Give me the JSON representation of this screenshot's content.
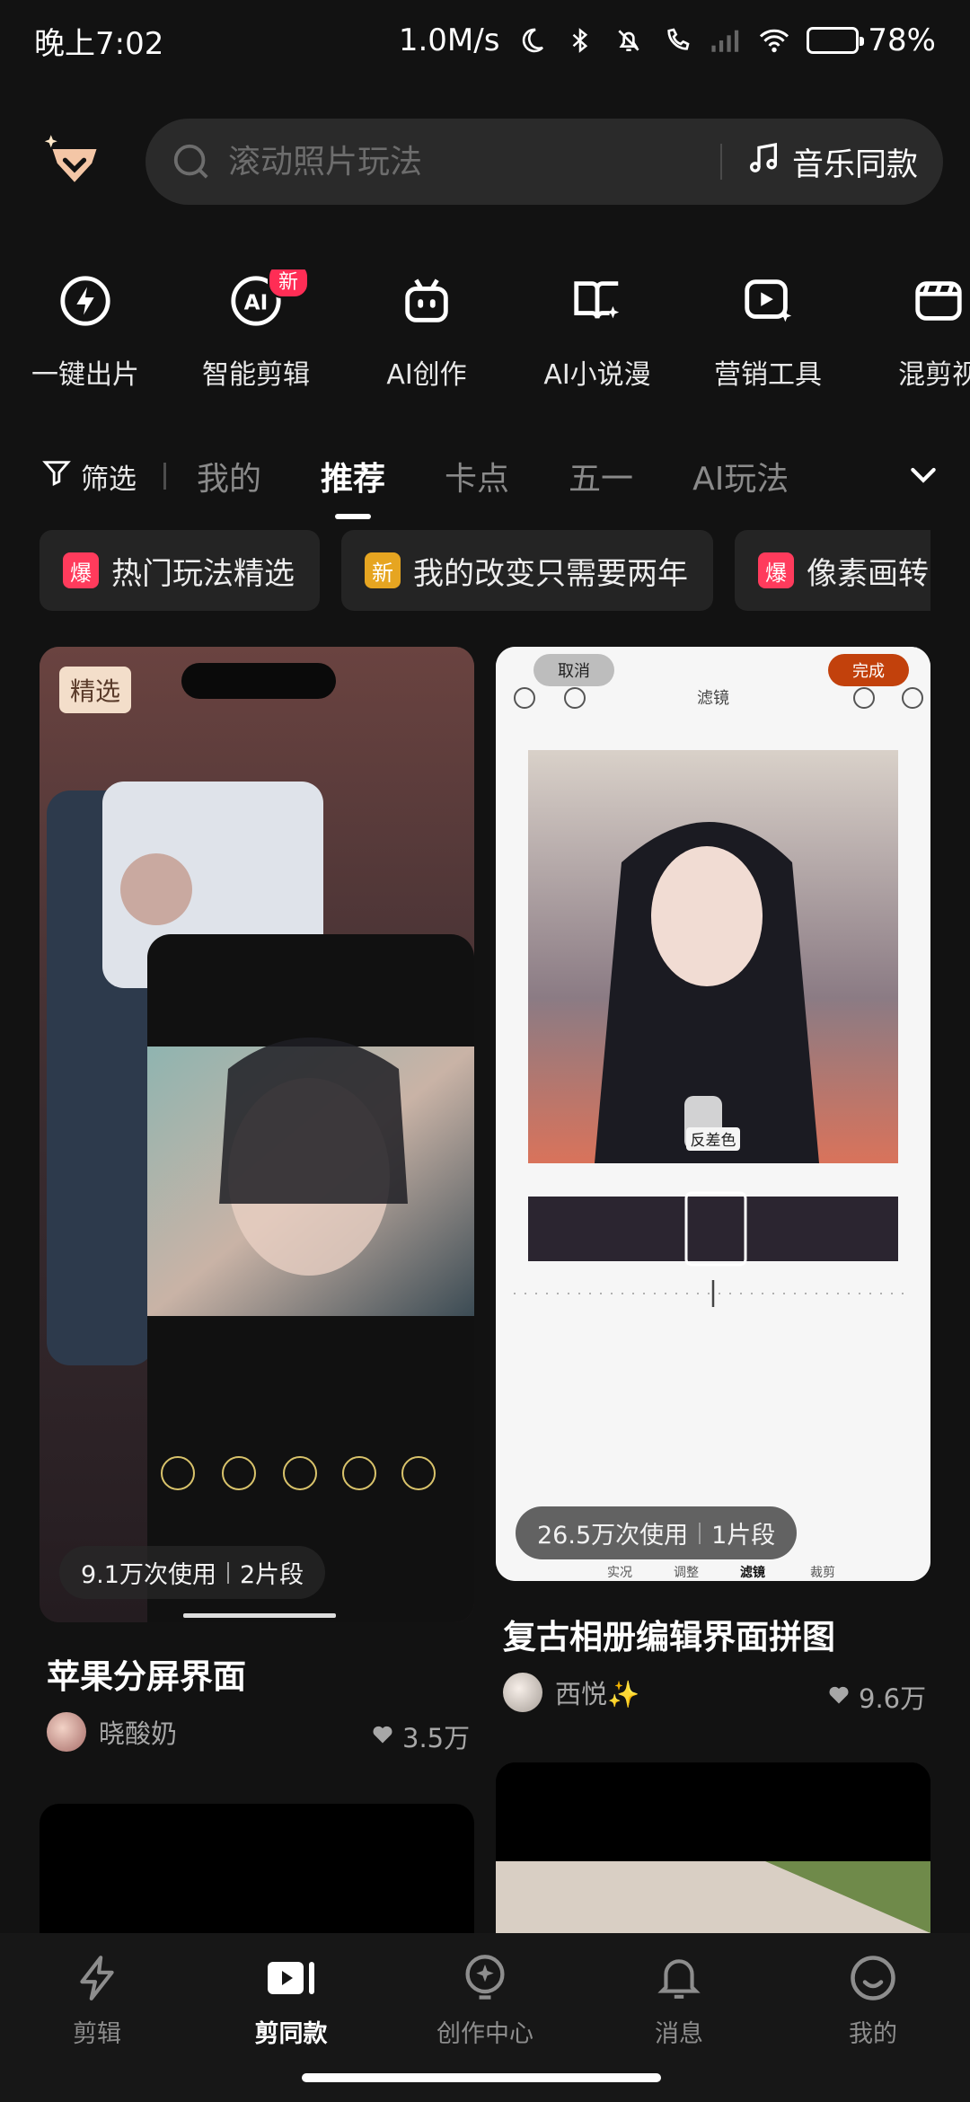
{
  "status_bar": {
    "time": "晚上7:02",
    "speed": "1.0M/s",
    "battery": "78%",
    "battery_level": 0.78
  },
  "search": {
    "placeholder": "滚动照片玩法",
    "music_label": "音乐同款"
  },
  "tools": [
    {
      "label": "一键出片",
      "icon": "lightning-circle-icon"
    },
    {
      "label": "智能剪辑",
      "icon": "ai-circle-icon",
      "badge": "新"
    },
    {
      "label": "AI创作",
      "icon": "robot-icon"
    },
    {
      "label": "AI小说漫",
      "icon": "book-sparkle-icon"
    },
    {
      "label": "营销工具",
      "icon": "play-sparkle-icon"
    },
    {
      "label": "混剪视",
      "icon": "clapper-icon"
    }
  ],
  "categories": {
    "filter_label": "筛选",
    "items": [
      "我的",
      "推荐",
      "卡点",
      "五一",
      "AI玩法"
    ],
    "active": "推荐"
  },
  "chips": [
    {
      "tag": "爆",
      "label": "热门玩法精选",
      "tag_color": "#ff3b5c"
    },
    {
      "tag": "新",
      "label": "我的改变只需要两年",
      "tag_color": "#e6a521"
    },
    {
      "tag": "爆",
      "label": "像素画转",
      "tag_color": "#ff3b5c"
    }
  ],
  "feed": [
    {
      "badge": "精选",
      "usage": "9.1万次使用",
      "segments": "2片段",
      "title": "苹果分屏界面",
      "author": "晓酸奶",
      "likes": "3.5万"
    },
    {
      "usage": "26.5万次使用",
      "segments": "1片段",
      "title": "复古相册编辑界面拼图",
      "author": "西悦✨",
      "likes": "9.6万",
      "preview": {
        "cancel": "取消",
        "done": "完成",
        "header": "滤镜",
        "filter_name": "反差色",
        "tabs": [
          "实况",
          "调整",
          "滤镜",
          "裁剪"
        ]
      }
    }
  ],
  "nav": [
    {
      "label": "剪辑",
      "icon": "lightning-icon"
    },
    {
      "label": "剪同款",
      "icon": "template-play-icon",
      "active": true
    },
    {
      "label": "创作中心",
      "icon": "bulb-icon"
    },
    {
      "label": "消息",
      "icon": "bell-icon"
    },
    {
      "label": "我的",
      "icon": "smile-icon"
    }
  ],
  "colors": {
    "accent": "#ff3b5c",
    "background": "#121212",
    "done_button": "#c2410c"
  }
}
